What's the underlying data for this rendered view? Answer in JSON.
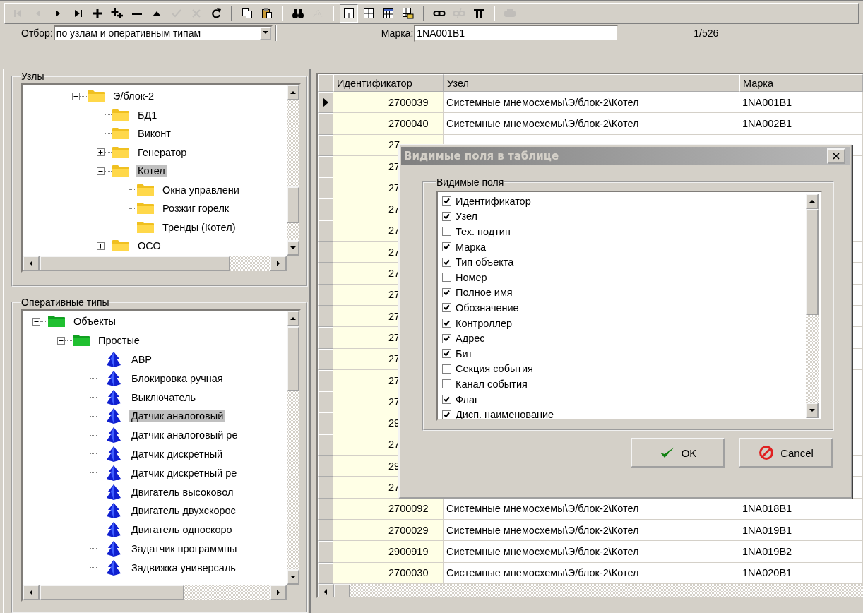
{
  "toolbar": [
    [
      {
        "kind": "first",
        "disabled": true
      },
      {
        "kind": "prev",
        "disabled": true
      },
      {
        "kind": "next",
        "disabled": false
      },
      {
        "kind": "last",
        "disabled": false
      },
      {
        "kind": "add",
        "disabled": false
      },
      {
        "kind": "add-many",
        "disabled": false
      },
      {
        "kind": "remove",
        "disabled": false
      },
      {
        "kind": "up",
        "disabled": false
      },
      {
        "kind": "apply",
        "disabled": true
      },
      {
        "kind": "cancel",
        "disabled": true
      },
      {
        "kind": "refresh",
        "disabled": false
      }
    ],
    [
      {
        "kind": "copy",
        "disabled": false
      },
      {
        "kind": "paste",
        "disabled": false
      }
    ],
    [
      {
        "kind": "find",
        "disabled": false
      },
      {
        "kind": "find-next",
        "disabled": true
      }
    ],
    [
      {
        "kind": "layout-h",
        "disabled": false,
        "selected": true
      },
      {
        "kind": "layout-v",
        "disabled": false,
        "selected": false
      },
      {
        "kind": "layout-calendar",
        "disabled": false,
        "selected": false
      },
      {
        "kind": "layout-export",
        "disabled": false,
        "selected": false
      }
    ],
    [
      {
        "kind": "link",
        "disabled": false
      },
      {
        "kind": "unlink",
        "disabled": true
      },
      {
        "kind": "pi",
        "disabled": false
      }
    ],
    [
      {
        "kind": "plugin",
        "disabled": true
      }
    ]
  ],
  "filter": {
    "label": "Отбор:",
    "value": "по узлам и оперативным типам"
  },
  "mark": {
    "label": "Марка:",
    "value": "1NA001B1"
  },
  "counter": "1/526",
  "nodes_tree": {
    "title": "Узлы",
    "items": [
      {
        "label": "Э/блок-2",
        "kind": "folder",
        "expanded": true,
        "selected": false,
        "children": [
          {
            "label": "БД1",
            "kind": "folder",
            "selected": false
          },
          {
            "label": "Виконт",
            "kind": "folder",
            "selected": false
          },
          {
            "label": "Генератор",
            "kind": "folder",
            "expanded": false,
            "selected": false
          },
          {
            "label": "Котел",
            "kind": "folder",
            "expanded": true,
            "selected": true,
            "children": [
              {
                "label": "Окна управлени",
                "kind": "folder",
                "selected": false
              },
              {
                "label": "Розжиг горелк",
                "kind": "folder",
                "selected": false
              },
              {
                "label": "Тренды (Котел)",
                "kind": "folder",
                "selected": false
              }
            ]
          },
          {
            "label": "ОСО",
            "kind": "folder",
            "expanded": false,
            "selected": false
          }
        ]
      }
    ]
  },
  "types_tree": {
    "title": "Оперативные типы",
    "items": [
      {
        "label": "Объекты",
        "kind": "group",
        "expanded": true,
        "selected": false,
        "children": [
          {
            "label": "Простые",
            "kind": "group",
            "expanded": true,
            "selected": false,
            "children": [
              {
                "label": "АВР",
                "kind": "type",
                "selected": false
              },
              {
                "label": "Блокировка ручная",
                "kind": "type",
                "selected": false
              },
              {
                "label": "Выключатель",
                "kind": "type",
                "selected": false
              },
              {
                "label": "Датчик аналоговый",
                "kind": "type",
                "selected": true
              },
              {
                "label": "Датчик аналоговый ре",
                "kind": "type",
                "selected": false
              },
              {
                "label": "Датчик дискретный",
                "kind": "type",
                "selected": false
              },
              {
                "label": "Датчик дискретный ре",
                "kind": "type",
                "selected": false
              },
              {
                "label": "Двигатель высоковол",
                "kind": "type",
                "selected": false
              },
              {
                "label": "Двигатель двухскорос",
                "kind": "type",
                "selected": false
              },
              {
                "label": "Двигатель односкоро",
                "kind": "type",
                "selected": false
              },
              {
                "label": "Задатчик программны",
                "kind": "type",
                "selected": false
              },
              {
                "label": "Задвижка универсаль",
                "kind": "type",
                "selected": false
              }
            ]
          }
        ]
      }
    ]
  },
  "grid": {
    "columns": [
      "Идентификатор",
      "Узел",
      "Марка"
    ],
    "rows": [
      {
        "id": "2700039",
        "node": "Системные мнемосхемы\\Э/блок-2\\Котел",
        "mark": "1NA001B1",
        "current": true
      },
      {
        "id": "2700040",
        "node": "Системные мнемосхемы\\Э/блок-2\\Котел",
        "mark": "1NA002B1",
        "current": false
      },
      {
        "id": "27",
        "current": false
      },
      {
        "id": "27",
        "current": false
      },
      {
        "id": "27",
        "current": false
      },
      {
        "id": "27",
        "current": false
      },
      {
        "id": "27",
        "current": false
      },
      {
        "id": "27",
        "current": false
      },
      {
        "id": "27",
        "current": false
      },
      {
        "id": "27",
        "current": false
      },
      {
        "id": "27",
        "current": false
      },
      {
        "id": "27",
        "current": false
      },
      {
        "id": "27",
        "current": false
      },
      {
        "id": "27",
        "current": false
      },
      {
        "id": "27",
        "current": false
      },
      {
        "id": "29",
        "current": false
      },
      {
        "id": "27",
        "current": false
      },
      {
        "id": "29",
        "current": false
      },
      {
        "id": "27",
        "current": false
      },
      {
        "id": "2700092",
        "node": "Системные мнемосхемы\\Э/блок-2\\Котел",
        "mark": "1NA018B1",
        "current": false
      },
      {
        "id": "2700029",
        "node": "Системные мнемосхемы\\Э/блок-2\\Котел",
        "mark": "1NA019B1",
        "current": false
      },
      {
        "id": "2900919",
        "node": "Системные мнемосхемы\\Э/блок-2\\Котел",
        "mark": "1NA019B2",
        "current": false
      },
      {
        "id": "2700030",
        "node": "Системные мнемосхемы\\Э/блок-2\\Котел",
        "mark": "1NA020B1",
        "current": false
      }
    ]
  },
  "dialog": {
    "title": "Видимые поля в таблице",
    "group": "Видимые поля",
    "fields": [
      {
        "label": "Идентификатор",
        "checked": true
      },
      {
        "label": "Узел",
        "checked": true
      },
      {
        "label": "Тех. подтип",
        "checked": false
      },
      {
        "label": "Марка",
        "checked": true
      },
      {
        "label": "Тип объекта",
        "checked": true
      },
      {
        "label": "Номер",
        "checked": false
      },
      {
        "label": "Полное имя",
        "checked": true
      },
      {
        "label": "Обозначение",
        "checked": true
      },
      {
        "label": "Контроллер",
        "checked": true
      },
      {
        "label": "Адрес",
        "checked": true
      },
      {
        "label": "Бит",
        "checked": true
      },
      {
        "label": "Секция события",
        "checked": false
      },
      {
        "label": "Канал события",
        "checked": false
      },
      {
        "label": "Флаг",
        "checked": true
      },
      {
        "label": "Дисп. наименование",
        "checked": true
      }
    ],
    "ok": "OK",
    "cancel": "Cancel"
  }
}
